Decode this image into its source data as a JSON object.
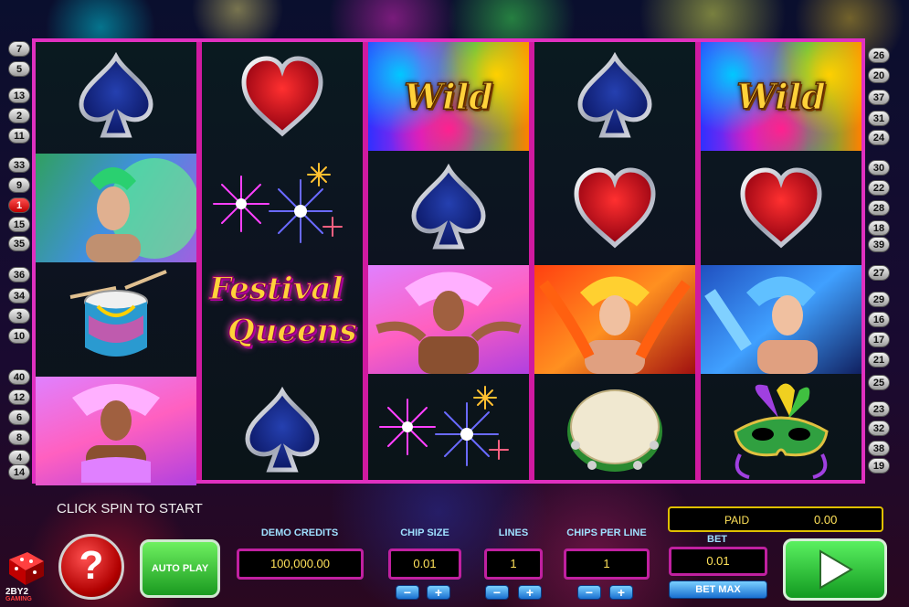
{
  "paylines_left": [
    "7",
    "5",
    "13",
    "2",
    "11",
    "33",
    "9",
    "1",
    "15",
    "35",
    "36",
    "34",
    "3",
    "10",
    "40",
    "12",
    "6",
    "8",
    "4",
    "14"
  ],
  "paylines_right": [
    "26",
    "20",
    "37",
    "31",
    "24",
    "30",
    "22",
    "28",
    "18",
    "39",
    "27",
    "29",
    "16",
    "17",
    "21",
    "25",
    "23",
    "32",
    "38",
    "19"
  ],
  "active_payline": "1",
  "reels": {
    "r1": [
      "spade",
      "dancer-green",
      "drum",
      "dancer-pink"
    ],
    "r2": [
      "heart",
      "fireworks",
      "festival-queens-logo",
      "spade"
    ],
    "r3": [
      "wild",
      "spade",
      "dancer-pink",
      "fireworks"
    ],
    "r4": [
      "spade",
      "heart",
      "dancer-red",
      "tambourine"
    ],
    "r5": [
      "wild",
      "heart",
      "dancer-blue",
      "mask"
    ]
  },
  "wild_text": "Wild",
  "logo": {
    "line1": "Festival",
    "line2": "Queens"
  },
  "status": "CLICK SPIN TO START",
  "demo_credits": {
    "label": "DEMO CREDITS",
    "value": "100,000.00"
  },
  "chip_size": {
    "label": "CHIP SIZE",
    "value": "0.01"
  },
  "lines": {
    "label": "LINES",
    "value": "1"
  },
  "chips_per_line": {
    "label": "CHIPS PER LINE",
    "value": "1"
  },
  "paid": {
    "label": "PAID",
    "value": "0.00"
  },
  "bet": {
    "label": "BET",
    "value": "0.01"
  },
  "buttons": {
    "help": "?",
    "autoplay": "AUTO PLAY",
    "bet_max": "BET MAX",
    "minus": "−",
    "plus": "+"
  },
  "brand": {
    "line1": "2BY2",
    "line2": "GAMING"
  },
  "colors": {
    "frame": "#d01aa0",
    "display_text": "#ffe25a",
    "label_text": "#9fe0ff",
    "spin_green": "#2ac040"
  }
}
